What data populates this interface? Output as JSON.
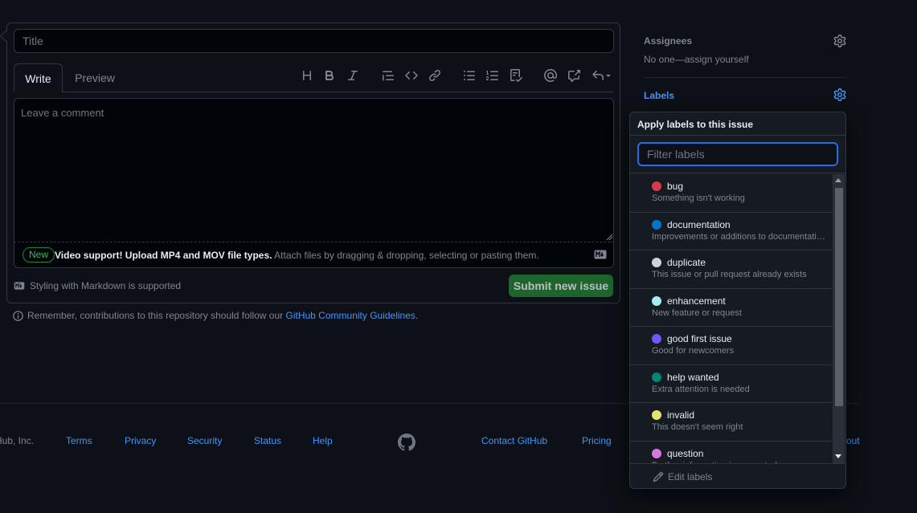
{
  "form": {
    "title_placeholder": "Title",
    "tabs": {
      "write": "Write",
      "preview": "Preview"
    },
    "toolbar_icons": [
      "heading-icon",
      "bold-icon",
      "italic-icon",
      "quote-icon",
      "code-icon",
      "link-icon",
      "bulleted-list-icon",
      "numbered-list-icon",
      "task-list-icon",
      "mention-icon",
      "cross-reference-icon",
      "saved-replies-icon"
    ],
    "comment_placeholder": "Leave a comment",
    "upload": {
      "badge": "New",
      "bold": "Video support! Upload MP4 and MOV file types.",
      "rest": " Attach files by dragging & dropping, selecting or pasting them."
    },
    "markdown_note": "Styling with Markdown is supported",
    "submit_label": "Submit new issue",
    "remember_prefix": "Remember, contributions to this repository should follow our ",
    "remember_link": "GitHub Community Guidelines",
    "remember_suffix": "."
  },
  "sidebar": {
    "assignees": {
      "heading": "Assignees",
      "value": "No one—assign yourself"
    },
    "labels": {
      "heading": "Labels"
    }
  },
  "labels_popover": {
    "header": "Apply labels to this issue",
    "filter_placeholder": "Filter labels",
    "items": [
      {
        "name": "bug",
        "description": "Something isn't working",
        "color": "#d73a4a"
      },
      {
        "name": "documentation",
        "description": "Improvements or additions to documentation",
        "color": "#0075ca"
      },
      {
        "name": "duplicate",
        "description": "This issue or pull request already exists",
        "color": "#cfd3d7"
      },
      {
        "name": "enhancement",
        "description": "New feature or request",
        "color": "#a2eeef"
      },
      {
        "name": "good first issue",
        "description": "Good for newcomers",
        "color": "#7057ff"
      },
      {
        "name": "help wanted",
        "description": "Extra attention is needed",
        "color": "#008672"
      },
      {
        "name": "invalid",
        "description": "This doesn't seem right",
        "color": "#e4e669"
      },
      {
        "name": "question",
        "description": "Further information is requested",
        "color": "#d876e3"
      }
    ],
    "footer": "Edit labels"
  },
  "footer": {
    "copyright": "Hub, Inc.",
    "links_left": [
      "Terms",
      "Privacy",
      "Security",
      "Status",
      "Help"
    ],
    "links_right": [
      "Contact GitHub",
      "Pricing"
    ],
    "trailing": "out"
  },
  "colors": {
    "background": "#0d1117",
    "accent_blue": "#4493f8",
    "submit_green": "#238636",
    "border": "#30363d"
  }
}
